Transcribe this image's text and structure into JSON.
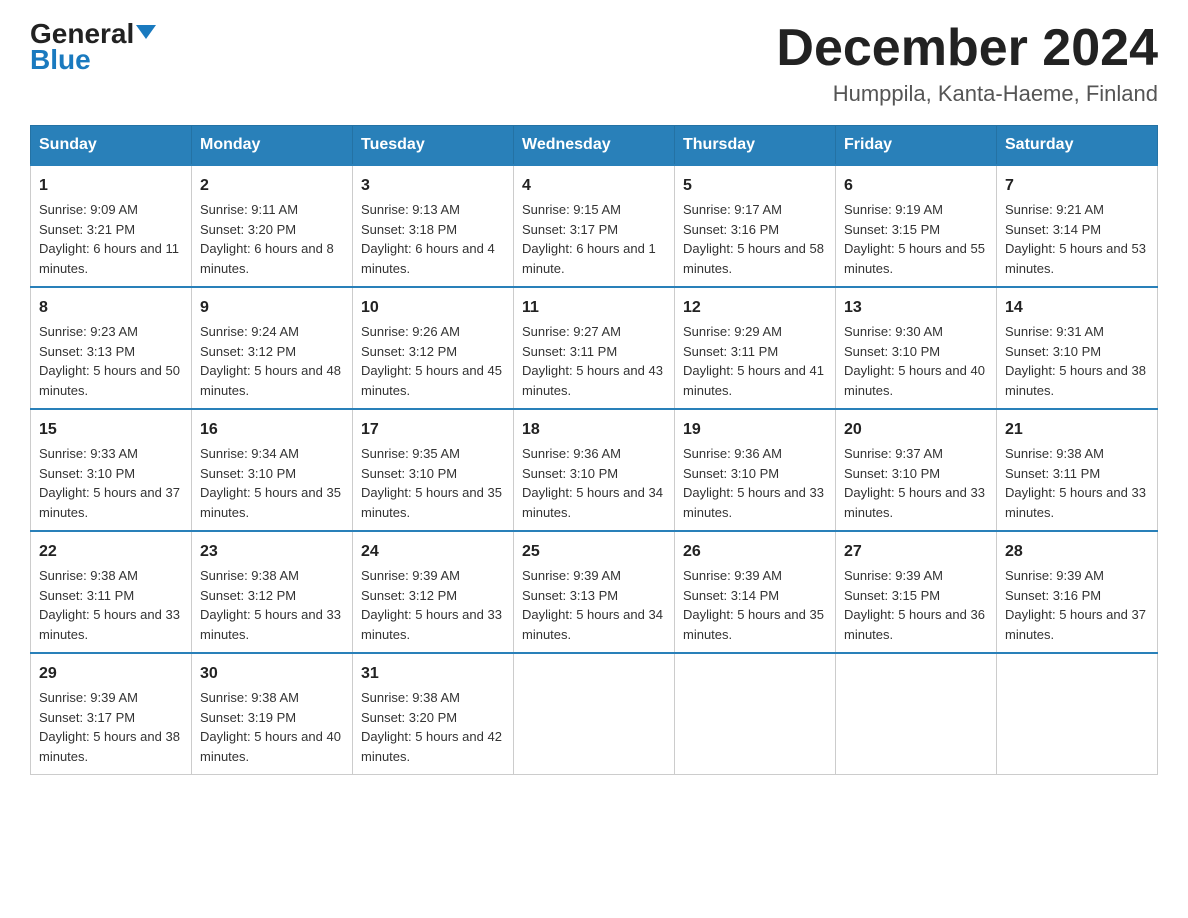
{
  "logo": {
    "text_general": "General",
    "text_blue": "Blue",
    "triangle_desc": "blue triangle logo"
  },
  "header": {
    "month_title": "December 2024",
    "location": "Humppila, Kanta-Haeme, Finland"
  },
  "days_of_week": [
    "Sunday",
    "Monday",
    "Tuesday",
    "Wednesday",
    "Thursday",
    "Friday",
    "Saturday"
  ],
  "weeks": [
    [
      {
        "day": "1",
        "sunrise": "9:09 AM",
        "sunset": "3:21 PM",
        "daylight": "6 hours and 11 minutes."
      },
      {
        "day": "2",
        "sunrise": "9:11 AM",
        "sunset": "3:20 PM",
        "daylight": "6 hours and 8 minutes."
      },
      {
        "day": "3",
        "sunrise": "9:13 AM",
        "sunset": "3:18 PM",
        "daylight": "6 hours and 4 minutes."
      },
      {
        "day": "4",
        "sunrise": "9:15 AM",
        "sunset": "3:17 PM",
        "daylight": "6 hours and 1 minute."
      },
      {
        "day": "5",
        "sunrise": "9:17 AM",
        "sunset": "3:16 PM",
        "daylight": "5 hours and 58 minutes."
      },
      {
        "day": "6",
        "sunrise": "9:19 AM",
        "sunset": "3:15 PM",
        "daylight": "5 hours and 55 minutes."
      },
      {
        "day": "7",
        "sunrise": "9:21 AM",
        "sunset": "3:14 PM",
        "daylight": "5 hours and 53 minutes."
      }
    ],
    [
      {
        "day": "8",
        "sunrise": "9:23 AM",
        "sunset": "3:13 PM",
        "daylight": "5 hours and 50 minutes."
      },
      {
        "day": "9",
        "sunrise": "9:24 AM",
        "sunset": "3:12 PM",
        "daylight": "5 hours and 48 minutes."
      },
      {
        "day": "10",
        "sunrise": "9:26 AM",
        "sunset": "3:12 PM",
        "daylight": "5 hours and 45 minutes."
      },
      {
        "day": "11",
        "sunrise": "9:27 AM",
        "sunset": "3:11 PM",
        "daylight": "5 hours and 43 minutes."
      },
      {
        "day": "12",
        "sunrise": "9:29 AM",
        "sunset": "3:11 PM",
        "daylight": "5 hours and 41 minutes."
      },
      {
        "day": "13",
        "sunrise": "9:30 AM",
        "sunset": "3:10 PM",
        "daylight": "5 hours and 40 minutes."
      },
      {
        "day": "14",
        "sunrise": "9:31 AM",
        "sunset": "3:10 PM",
        "daylight": "5 hours and 38 minutes."
      }
    ],
    [
      {
        "day": "15",
        "sunrise": "9:33 AM",
        "sunset": "3:10 PM",
        "daylight": "5 hours and 37 minutes."
      },
      {
        "day": "16",
        "sunrise": "9:34 AM",
        "sunset": "3:10 PM",
        "daylight": "5 hours and 35 minutes."
      },
      {
        "day": "17",
        "sunrise": "9:35 AM",
        "sunset": "3:10 PM",
        "daylight": "5 hours and 35 minutes."
      },
      {
        "day": "18",
        "sunrise": "9:36 AM",
        "sunset": "3:10 PM",
        "daylight": "5 hours and 34 minutes."
      },
      {
        "day": "19",
        "sunrise": "9:36 AM",
        "sunset": "3:10 PM",
        "daylight": "5 hours and 33 minutes."
      },
      {
        "day": "20",
        "sunrise": "9:37 AM",
        "sunset": "3:10 PM",
        "daylight": "5 hours and 33 minutes."
      },
      {
        "day": "21",
        "sunrise": "9:38 AM",
        "sunset": "3:11 PM",
        "daylight": "5 hours and 33 minutes."
      }
    ],
    [
      {
        "day": "22",
        "sunrise": "9:38 AM",
        "sunset": "3:11 PM",
        "daylight": "5 hours and 33 minutes."
      },
      {
        "day": "23",
        "sunrise": "9:38 AM",
        "sunset": "3:12 PM",
        "daylight": "5 hours and 33 minutes."
      },
      {
        "day": "24",
        "sunrise": "9:39 AM",
        "sunset": "3:12 PM",
        "daylight": "5 hours and 33 minutes."
      },
      {
        "day": "25",
        "sunrise": "9:39 AM",
        "sunset": "3:13 PM",
        "daylight": "5 hours and 34 minutes."
      },
      {
        "day": "26",
        "sunrise": "9:39 AM",
        "sunset": "3:14 PM",
        "daylight": "5 hours and 35 minutes."
      },
      {
        "day": "27",
        "sunrise": "9:39 AM",
        "sunset": "3:15 PM",
        "daylight": "5 hours and 36 minutes."
      },
      {
        "day": "28",
        "sunrise": "9:39 AM",
        "sunset": "3:16 PM",
        "daylight": "5 hours and 37 minutes."
      }
    ],
    [
      {
        "day": "29",
        "sunrise": "9:39 AM",
        "sunset": "3:17 PM",
        "daylight": "5 hours and 38 minutes."
      },
      {
        "day": "30",
        "sunrise": "9:38 AM",
        "sunset": "3:19 PM",
        "daylight": "5 hours and 40 minutes."
      },
      {
        "day": "31",
        "sunrise": "9:38 AM",
        "sunset": "3:20 PM",
        "daylight": "5 hours and 42 minutes."
      },
      null,
      null,
      null,
      null
    ]
  ],
  "labels": {
    "sunrise": "Sunrise:",
    "sunset": "Sunset:",
    "daylight": "Daylight:"
  }
}
